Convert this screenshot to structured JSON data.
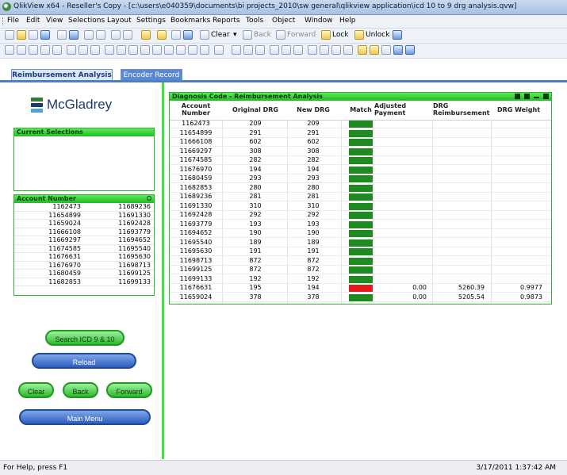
{
  "window": {
    "title": "QlikView x64 - Reseller's Copy - [c:\\users\\e040359\\documents\\bi projects_2010\\sw general\\qlikview application\\icd 10 to 9 drg analysis.qvw]"
  },
  "menu": [
    "File",
    "Edit",
    "View",
    "Selections",
    "Layout",
    "Settings",
    "Bookmarks",
    "Reports",
    "Tools",
    "Object",
    "Window",
    "Help"
  ],
  "toolbar": {
    "clear_label": "Clear",
    "back_label": "Back",
    "forward_label": "Forward",
    "lock_label": "Lock",
    "unlock_label": "Unlock"
  },
  "tabs": [
    {
      "label": "Reimbursement Analysis",
      "active": true
    },
    {
      "label": "Encoder Record",
      "active": false
    }
  ],
  "logo": {
    "text": "McGladrey"
  },
  "current_selections": {
    "title": "Current Selections"
  },
  "account_list": {
    "title": "Account Number",
    "col1": [
      "1162473",
      "11654899",
      "11659024",
      "11666108",
      "11669297",
      "11674585",
      "11676631",
      "11676970",
      "11680459",
      "11682853"
    ],
    "col2": [
      "11689236",
      "11691330",
      "11692428",
      "11693779",
      "11694652",
      "11695540",
      "11695630",
      "11698713",
      "11699125",
      "11699133"
    ]
  },
  "buttons": {
    "search": "Search ICD 9 & 10",
    "reload": "Reload",
    "clear": "Clear",
    "back": "Back",
    "forward": "Forward",
    "main_menu": "Main Menu"
  },
  "table": {
    "title": "Diagnosis Code - Reimbursement Analysis",
    "headers": {
      "account": "Account Number",
      "orig_drg": "Original DRG",
      "new_drg": "New DRG",
      "match": "Match",
      "adj_payment": "Adjusted Payment",
      "drg_reimb": "DRG Reimbursement",
      "drg_weight": "DRG Weight"
    },
    "colors": {
      "match": "#1f8a1f",
      "mismatch": "#e31b1b",
      "header_green": "#2fc72f"
    },
    "rows": [
      {
        "account": "1162473",
        "orig": "209",
        "new": "209",
        "match": true,
        "adj": "",
        "reimb": "",
        "weight": ""
      },
      {
        "account": "11654899",
        "orig": "291",
        "new": "291",
        "match": true,
        "adj": "",
        "reimb": "",
        "weight": ""
      },
      {
        "account": "11666108",
        "orig": "602",
        "new": "602",
        "match": true,
        "adj": "",
        "reimb": "",
        "weight": ""
      },
      {
        "account": "11669297",
        "orig": "308",
        "new": "308",
        "match": true,
        "adj": "",
        "reimb": "",
        "weight": ""
      },
      {
        "account": "11674585",
        "orig": "282",
        "new": "282",
        "match": true,
        "adj": "",
        "reimb": "",
        "weight": ""
      },
      {
        "account": "11676970",
        "orig": "194",
        "new": "194",
        "match": true,
        "adj": "",
        "reimb": "",
        "weight": ""
      },
      {
        "account": "11680459",
        "orig": "293",
        "new": "293",
        "match": true,
        "adj": "",
        "reimb": "",
        "weight": ""
      },
      {
        "account": "11682853",
        "orig": "280",
        "new": "280",
        "match": true,
        "adj": "",
        "reimb": "",
        "weight": ""
      },
      {
        "account": "11689236",
        "orig": "281",
        "new": "281",
        "match": true,
        "adj": "",
        "reimb": "",
        "weight": ""
      },
      {
        "account": "11691330",
        "orig": "310",
        "new": "310",
        "match": true,
        "adj": "",
        "reimb": "",
        "weight": ""
      },
      {
        "account": "11692428",
        "orig": "292",
        "new": "292",
        "match": true,
        "adj": "",
        "reimb": "",
        "weight": ""
      },
      {
        "account": "11693779",
        "orig": "193",
        "new": "193",
        "match": true,
        "adj": "",
        "reimb": "",
        "weight": ""
      },
      {
        "account": "11694652",
        "orig": "190",
        "new": "190",
        "match": true,
        "adj": "",
        "reimb": "",
        "weight": ""
      },
      {
        "account": "11695540",
        "orig": "189",
        "new": "189",
        "match": true,
        "adj": "",
        "reimb": "",
        "weight": ""
      },
      {
        "account": "11695630",
        "orig": "191",
        "new": "191",
        "match": true,
        "adj": "",
        "reimb": "",
        "weight": ""
      },
      {
        "account": "11698713",
        "orig": "872",
        "new": "872",
        "match": true,
        "adj": "",
        "reimb": "",
        "weight": ""
      },
      {
        "account": "11699125",
        "orig": "872",
        "new": "872",
        "match": true,
        "adj": "",
        "reimb": "",
        "weight": ""
      },
      {
        "account": "11699133",
        "orig": "192",
        "new": "192",
        "match": true,
        "adj": "",
        "reimb": "",
        "weight": ""
      },
      {
        "account": "11676631",
        "orig": "195",
        "new": "194",
        "match": false,
        "adj": "0.00",
        "reimb": "5260.39",
        "weight": "0.9977"
      },
      {
        "account": "11659024",
        "orig": "378",
        "new": "378",
        "match": true,
        "adj": "0.00",
        "reimb": "5205.54",
        "weight": "0.9873"
      }
    ]
  },
  "status": {
    "help": "For Help, press F1",
    "datetime": "3/17/2011 1:37:42 AM"
  }
}
